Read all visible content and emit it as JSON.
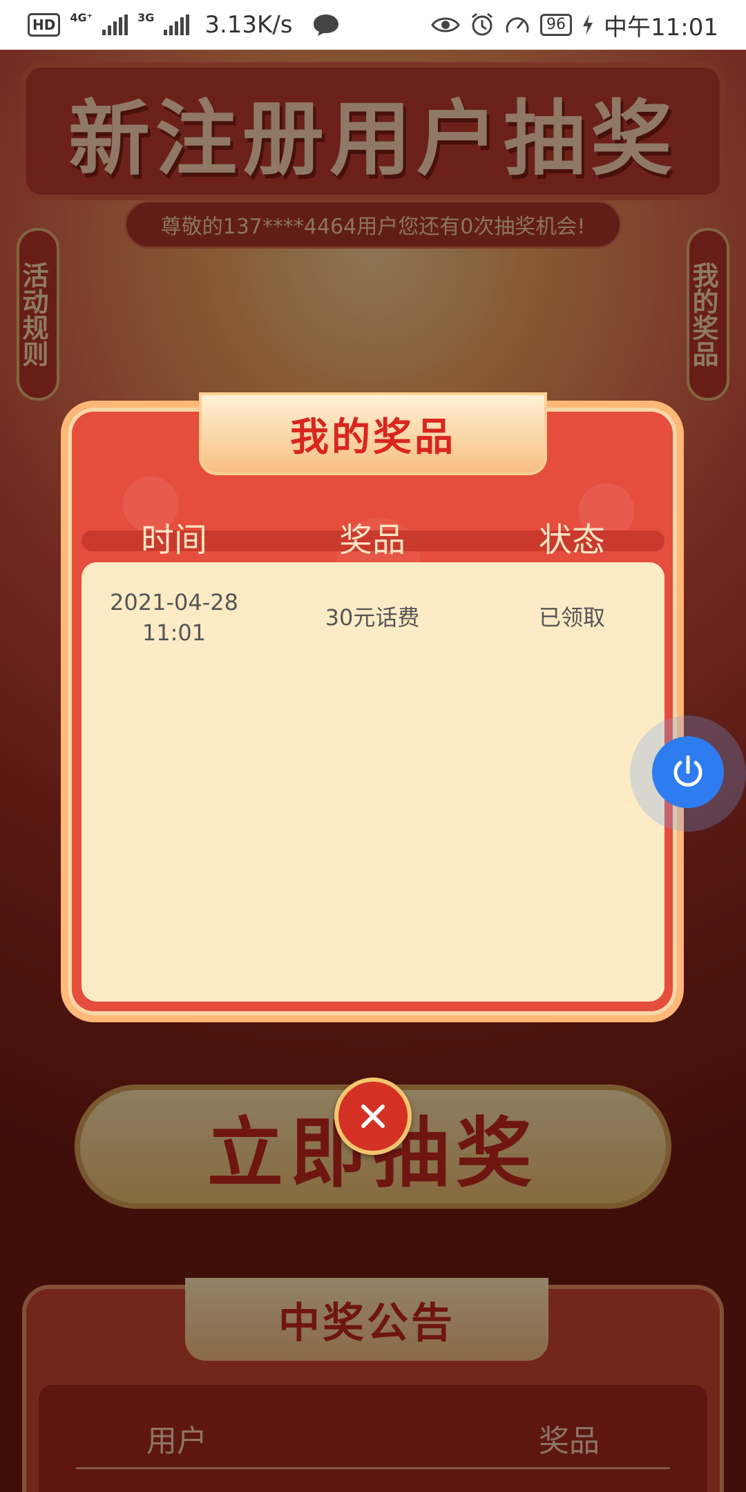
{
  "status_bar": {
    "hd": "HD",
    "network_1": "4G⁺",
    "network_2": "3G",
    "speed": "3.13K/s",
    "battery": "96",
    "time": "中午11:01"
  },
  "page": {
    "banner_title": "新注册用户抽奖",
    "subtitle": "尊敬的137****4464用户您还有0次抽奖机会!",
    "rules_tab": "活动规则",
    "my_prizes_tab": "我的奖品",
    "draw_button": "立即抽奖",
    "notice_title": "中奖公告",
    "notice_columns": [
      "用户",
      "奖品"
    ]
  },
  "modal": {
    "title": "我的奖品",
    "columns": [
      "时间",
      "奖品",
      "状态"
    ],
    "rows": [
      {
        "date": "2021-04-28",
        "time": "11:01",
        "prize": "30元话费",
        "status": "已领取"
      }
    ]
  },
  "colors": {
    "modal_red": "#e54d3d",
    "panel_cream": "#fdebc6",
    "float_blue": "#2f7cf0"
  },
  "icons": [
    "chat-bubble-icon",
    "eye-icon",
    "alarm-icon",
    "speedometer-icon",
    "power-icon",
    "close-icon"
  ]
}
